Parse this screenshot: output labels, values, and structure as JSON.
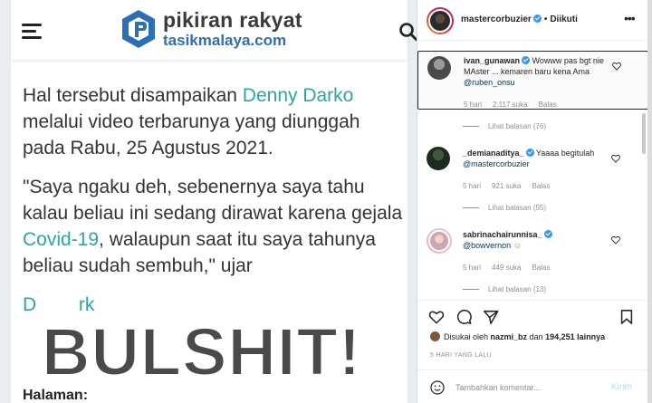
{
  "article": {
    "site_title": "pikiran rakyat",
    "site_sub": "tasikmalaya.com",
    "p1_a": "Hal tersebut disampaikan ",
    "p1_link": "Denny Darko",
    "p1_b": " melalui video terbarunya yang diunggah pada Rabu, 25 Agustus 2021.",
    "p2_a": "\"Saya ngaku deh, sebenernya saya tahu kalau beliau ini sedang dirawat karena gejala ",
    "p2_link": "Covid-19",
    "p2_b": ", walaupun saat itu saya tahunya beliau sudah sembuh,\" ujar",
    "p3_partial": "D        rk",
    "overlay": "BULSHIT!",
    "footer": "Halaman:"
  },
  "instagram": {
    "username": "mastercorbuzier",
    "follow_status": "Diikuti",
    "comments": [
      {
        "user": "ivan_gunawan",
        "text": "Wowww pas bgt nie MAster ... kemaren baru kena Ama ",
        "mention": "@ruben_onsu",
        "time": "5 hari",
        "likes": "2.117 suka",
        "reply": "Balas",
        "view_replies": "Lihat balasan (76)"
      },
      {
        "user": "_demianaditya_",
        "text": "Yaaaa begitulah ",
        "mention": "@mastercorbuzier",
        "time": "5 hari",
        "likes": "921 suka",
        "reply": "Balas",
        "view_replies": "Lihat balasan (55)"
      },
      {
        "user": "sabrinachairunnisa_",
        "text": "",
        "mention": "@bowvernon",
        "emoji": "☺",
        "time": "5 hari",
        "likes": "449 suka",
        "reply": "Balas",
        "view_replies": "Lihat balasan (13)"
      }
    ],
    "liked_by_prefix": "Disukai oleh ",
    "liked_by_user": "nazmi_bz",
    "liked_by_mid": " dan ",
    "liked_by_count": "194,251 lainnya",
    "time_ago": "5 HARI YANG LALU",
    "comment_placeholder": "Tambahkan komentar...",
    "post_label": "Kirim"
  },
  "colors": {
    "brand_blue": "#2d6fb6",
    "link_teal": "#2aa7a0",
    "ig_verified": "#3897f0",
    "post_disabled": "#b2dffc"
  }
}
